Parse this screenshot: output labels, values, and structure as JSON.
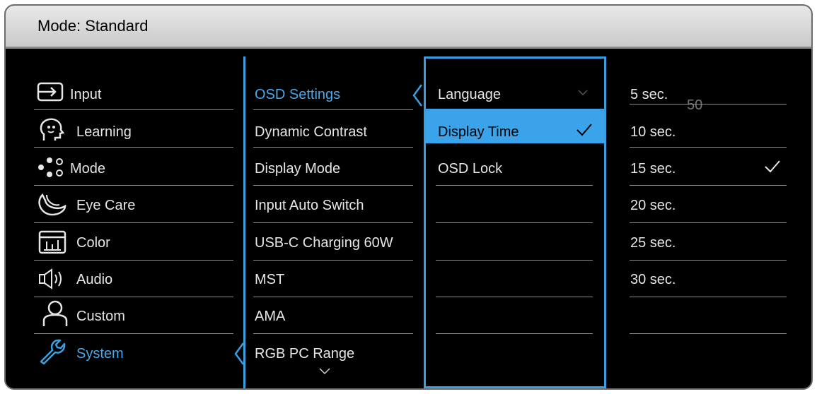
{
  "header": {
    "title": "Mode: Standard"
  },
  "main_menu": [
    {
      "label": "Input",
      "icon": "input-icon"
    },
    {
      "label": "Learning",
      "icon": "learning-icon"
    },
    {
      "label": "Mode",
      "icon": "mode-icon"
    },
    {
      "label": "Eye Care",
      "icon": "eye-care-icon"
    },
    {
      "label": "Color",
      "icon": "color-icon"
    },
    {
      "label": "Audio",
      "icon": "audio-icon"
    },
    {
      "label": "Custom",
      "icon": "custom-icon"
    },
    {
      "label": "System",
      "icon": "system-icon",
      "selected": true
    }
  ],
  "system_menu": [
    {
      "label": "OSD Settings",
      "selected": true
    },
    {
      "label": "Dynamic Contrast"
    },
    {
      "label": "Display Mode"
    },
    {
      "label": "Input Auto Switch"
    },
    {
      "label": "USB-C Charging 60W"
    },
    {
      "label": "MST"
    },
    {
      "label": "AMA"
    },
    {
      "label": "RGB PC Range"
    }
  ],
  "osd_menu": [
    {
      "label": "Language"
    },
    {
      "label": "Display Time",
      "highlighted": true,
      "checked": true
    },
    {
      "label": "OSD Lock"
    }
  ],
  "display_time_options": [
    {
      "label": "5 sec."
    },
    {
      "label": "10 sec."
    },
    {
      "label": "15 sec.",
      "checked": true
    },
    {
      "label": "20 sec."
    },
    {
      "label": "25 sec."
    },
    {
      "label": "30 sec."
    }
  ],
  "overlay_value": "50",
  "colors": {
    "accent": "#3aa3ea",
    "background": "#000000",
    "text": "#e6e6e6"
  }
}
